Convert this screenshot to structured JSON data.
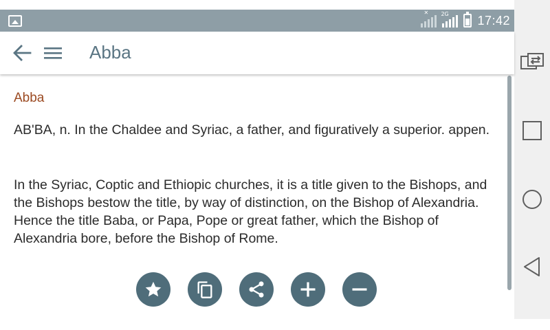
{
  "status_bar": {
    "time": "17:42",
    "sim1_label": "",
    "sim2_label": "2G"
  },
  "toolbar": {
    "title": "Abba"
  },
  "entry": {
    "headword": "Abba",
    "paragraphs": [
      "AB'BA, n. In the Chaldee and Syriac, a father, and figuratively a superior. appen.",
      "In the Syriac, Coptic and Ethiopic churches, it is a title given to the Bishops, and the Bishops bestow the title, by way of distinction, on the Bishop of Alexandria. Hence the title Baba, or Papa, Pope or great father, which the Bishop of Alexandria bore, before the Bishop of Rome."
    ]
  },
  "actions": [
    {
      "icon": "star-icon"
    },
    {
      "icon": "copy-icon"
    },
    {
      "icon": "share-icon"
    },
    {
      "icon": "plus-icon"
    },
    {
      "icon": "minus-icon"
    }
  ],
  "colors": {
    "status_bar": "#8e9ea6",
    "title": "#5a7583",
    "headword": "#9b4a22",
    "fab": "#4f6d7a",
    "nav_bar": "#f0f0f0"
  }
}
